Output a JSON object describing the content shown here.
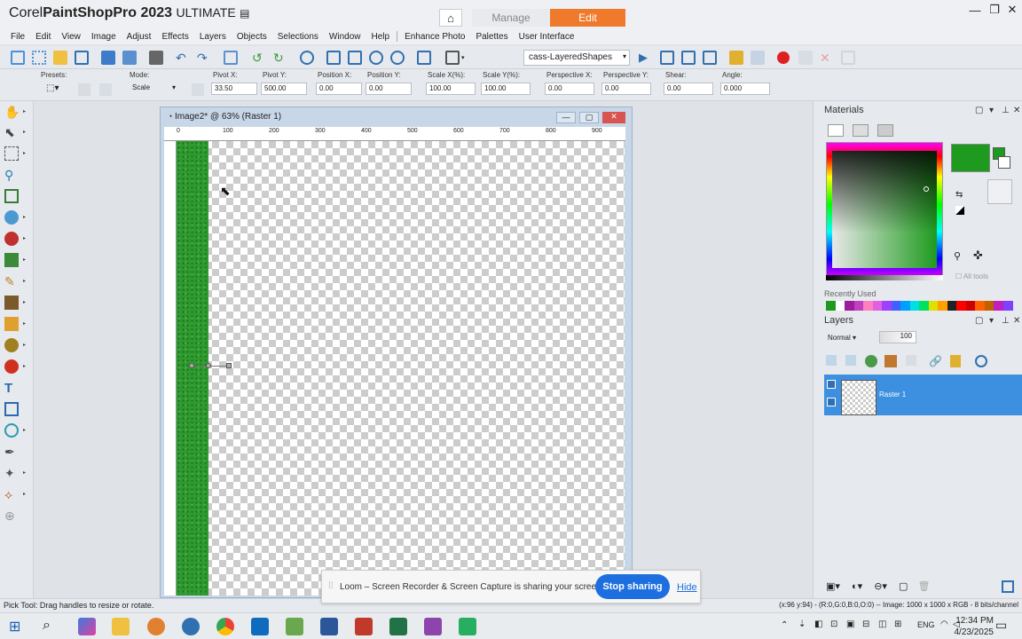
{
  "app": {
    "title_brand": "Corel",
    "title_name": "PaintShop",
    "title_pro": "Pro 2023",
    "title_edition": "ULTIMATE"
  },
  "workspace_tabs": {
    "home": "⌂",
    "manage": "Manage",
    "edit": "Edit"
  },
  "window_controls": {
    "minimize": "—",
    "restore": "❐",
    "close": "✕"
  },
  "menu": [
    "File",
    "Edit",
    "View",
    "Image",
    "Adjust",
    "Effects",
    "Layers",
    "Objects",
    "Selections",
    "Window",
    "Help",
    "Enhance Photo",
    "Palettes",
    "User Interface"
  ],
  "toolbar": {
    "preset_value": "cass-LayeredShapes"
  },
  "options": {
    "presets_label": "Presets:",
    "mode_label": "Mode:",
    "mode_value": "Scale",
    "pivot_x_label": "Pivot X:",
    "pivot_x_value": "33.50",
    "pivot_y_label": "Pivot Y:",
    "pivot_y_value": "500.00",
    "position_x_label": "Position X:",
    "position_x_value": "0.00",
    "position_y_label": "Position Y:",
    "position_y_value": "0.00",
    "scale_x_label": "Scale X(%):",
    "scale_x_value": "100.00",
    "scale_y_label": "Scale Y(%):",
    "scale_y_value": "100.00",
    "persp_x_label": "Perspective X:",
    "persp_x_value": "0.00",
    "persp_y_label": "Perspective Y:",
    "persp_y_value": "0.00",
    "shear_label": "Shear:",
    "shear_value": "0.00",
    "angle_label": "Angle:",
    "angle_value": "0.000"
  },
  "document": {
    "title": "Image2* @  63% (Raster 1)",
    "ruler_marks": [
      "0",
      "100",
      "200",
      "300",
      "400",
      "500",
      "600",
      "700",
      "800",
      "900"
    ]
  },
  "materials": {
    "title": "Materials",
    "recently_used": "Recently Used",
    "all_tools": "All tools",
    "fg_color": "#1e9b1e",
    "recent_colors": [
      "#1e9b1e",
      "#ffffff",
      "#9b1e9b",
      "#c040c0",
      "#ff80c0",
      "#e060e0",
      "#a040ff",
      "#4060ff",
      "#00a0ff",
      "#00e0e0",
      "#00e060",
      "#e0e000",
      "#ffa000",
      "#222222",
      "#ff0000",
      "#cc0000",
      "#ff6000",
      "#c06000",
      "#c020c0",
      "#8040ff"
    ]
  },
  "layers": {
    "title": "Layers",
    "blend_mode": "Normal",
    "opacity": "100",
    "layer_name": "Raster 1"
  },
  "status": {
    "left": "Pick Tool: Drag handles to resize or rotate.",
    "right": "(x:96 y:94) - (R:0,G:0,B:0,O:0) -- Image:  1000 x 1000 x RGB - 8 bits/channel"
  },
  "loom": {
    "message": "Loom – Screen Recorder & Screen Capture is sharing your screen.",
    "stop": "Stop sharing",
    "hide": "Hide"
  },
  "taskbar": {
    "lang": "ENG",
    "time": "12:34 PM",
    "date": "4/23/2025"
  }
}
